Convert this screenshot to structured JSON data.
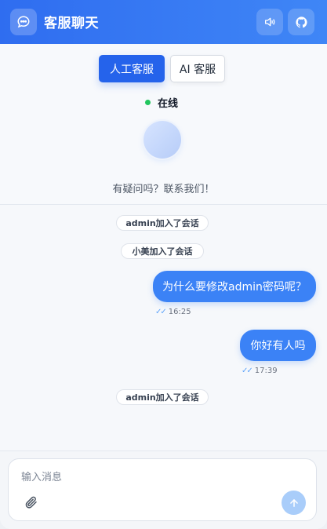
{
  "header": {
    "title": "客服聊天",
    "logo_icon": "chat-bubble-icon",
    "sound_icon": "speaker-icon",
    "github_icon": "github-icon"
  },
  "tabs": [
    {
      "label": "人工客服",
      "active": true
    },
    {
      "label": "AI 客服",
      "active": false
    }
  ],
  "status": {
    "label": "在线",
    "color": "#22c55e"
  },
  "welcome_text": "有疑问吗？联系我们！",
  "messages": [
    {
      "type": "system",
      "text": "admin加入了会话"
    },
    {
      "type": "system",
      "text": "小美加入了会话"
    },
    {
      "type": "outgoing",
      "text": "为什么要修改admin密码呢？",
      "time": "16:25",
      "read": true
    },
    {
      "type": "outgoing",
      "text": "你好有人吗",
      "time": "17:39",
      "read": true
    },
    {
      "type": "system",
      "text": "admin加入了会话"
    }
  ],
  "composer": {
    "placeholder": "输入消息",
    "value": "",
    "attach_icon": "paperclip-icon",
    "send_icon": "arrow-up-icon"
  },
  "colors": {
    "primary": "#2563eb",
    "bubble": "#3b82f6",
    "send_disabled": "#a9cdfa"
  }
}
